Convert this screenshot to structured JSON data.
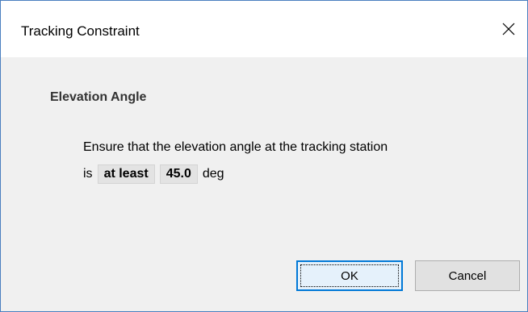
{
  "window": {
    "title": "Tracking Constraint"
  },
  "content": {
    "heading": "Elevation Angle",
    "description": "Ensure that the elevation angle at the tracking station",
    "prefix": "is",
    "operator": "at least",
    "value": "45.0",
    "unit": "deg"
  },
  "buttons": {
    "ok_label": "OK",
    "cancel_label": "Cancel"
  },
  "icons": {
    "close": "close-icon"
  },
  "colors": {
    "window_border": "#4a7fbf",
    "dialog_bg": "#f0f0f0",
    "default_button_border": "#0078d7"
  }
}
